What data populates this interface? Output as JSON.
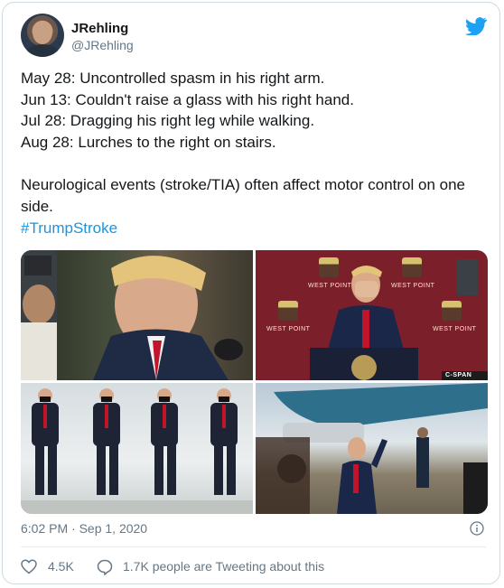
{
  "user": {
    "display_name": "JRehling",
    "handle": "@JRehling"
  },
  "tweet": {
    "text": "May 28: Uncontrolled spasm in his right arm.\nJun 13: Couldn't raise a glass with his right hand.\nJul 28: Dragging his right leg while walking.\nAug 28: Lurches to the right on stairs.\n\nNeurological events (stroke/TIA) often affect motor control on one side.",
    "hashtag": "#TrumpStroke",
    "timestamp": "6:02 PM · Sep 1, 2020"
  },
  "media": {
    "photo2_labels": [
      "WEST POINT",
      "WEST POINT",
      "WEST POINT",
      "WEST POINT",
      "C-SPAN"
    ]
  },
  "engagement": {
    "likes": "4.5K",
    "tweeting": "1.7K people are Tweeting about this"
  },
  "colors": {
    "accent": "#1da1f2",
    "link": "#1b95e0",
    "muted": "#657786"
  },
  "icons": {
    "brand": "twitter-bird-icon",
    "info": "info-icon",
    "like": "heart-icon",
    "reply": "speech-bubble-icon"
  }
}
